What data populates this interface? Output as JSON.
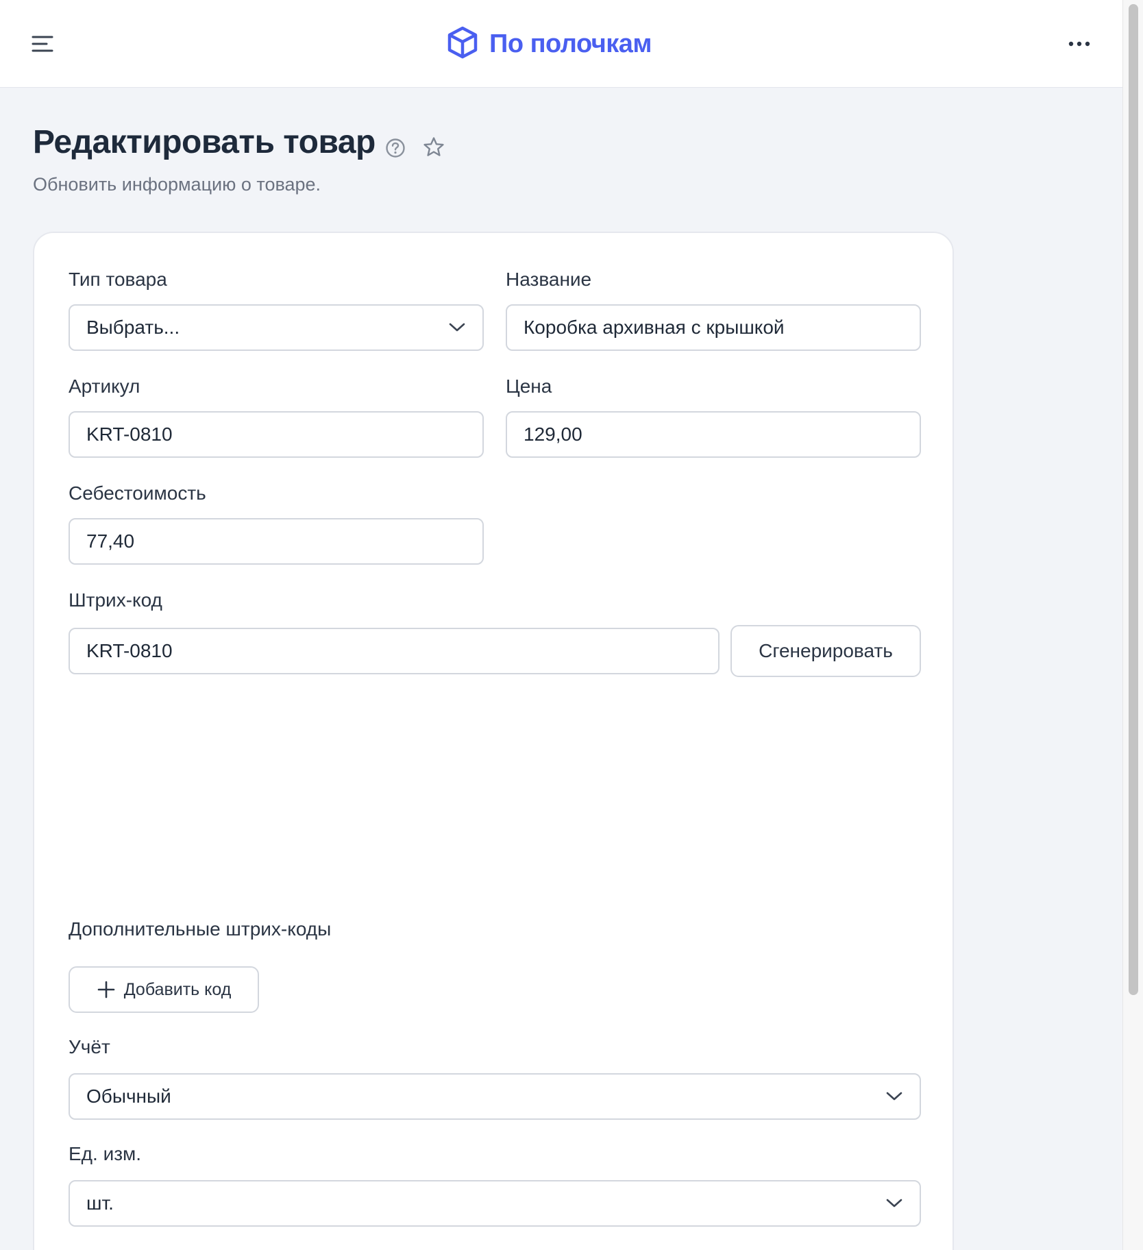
{
  "header": {
    "brand": "По полочкам",
    "brand_color": "#4a5ff0",
    "icons": [
      "menu-icon",
      "box-logo-icon",
      "more-horizontal-icon"
    ]
  },
  "page": {
    "title": "Редактировать товар",
    "subtitle": "Обновить информацию о товаре.",
    "icons": [
      "help-icon",
      "star-icon"
    ]
  },
  "form": {
    "type": {
      "label": "Тип товара",
      "value": "Выбрать..."
    },
    "name": {
      "label": "Название",
      "value": "Коробка архивная с крышкой"
    },
    "sku": {
      "label": "Артикул",
      "value": "KRT-0810"
    },
    "price": {
      "label": "Цена",
      "value": "129,00"
    },
    "cost": {
      "label": "Себестоимость",
      "value": "77,40"
    },
    "barcode": {
      "label": "Штрих-код",
      "value": "KRT-0810",
      "generate_label": "Сгенерировать"
    },
    "extra_barcodes": {
      "label": "Дополнительные штрих-коды",
      "add_label": "Добавить код"
    },
    "accounting": {
      "label": "Учёт",
      "value": "Обычный"
    },
    "unit": {
      "label": "Ед. изм.",
      "value": "шт."
    }
  }
}
